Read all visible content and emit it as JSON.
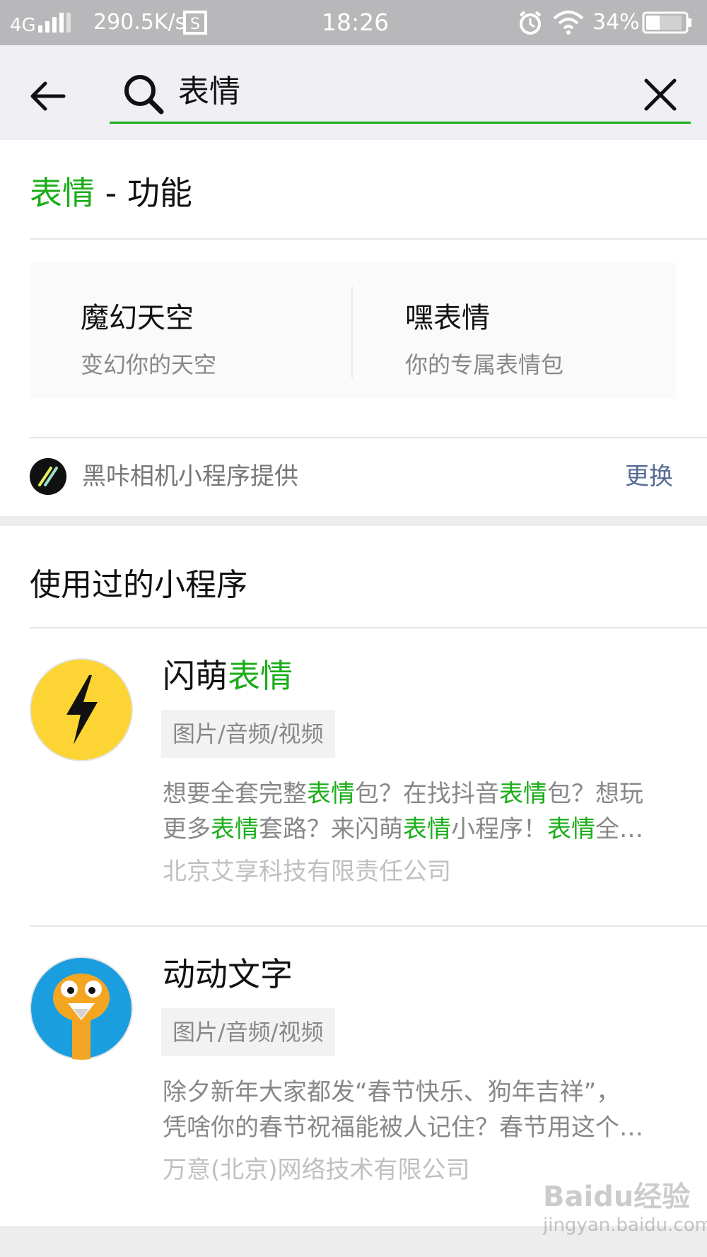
{
  "status_bar": {
    "network": "4G",
    "speed": "290.5K/s",
    "time": "18:26",
    "battery": "34%"
  },
  "search": {
    "query": "表情"
  },
  "function_section": {
    "title_highlight": "表情",
    "title_rest": " - 功能",
    "items": [
      {
        "title": "魔幻天空",
        "subtitle": "变幻你的天空"
      },
      {
        "title": "嘿表情",
        "subtitle": "你的专属表情包"
      }
    ],
    "provider": "黑咔相机小程序提供",
    "change_label": "更换"
  },
  "used_section": {
    "title": "使用过的小程序",
    "apps": [
      {
        "name_plain": "闪萌",
        "name_highlight": "表情",
        "tag": "图片/音频/视频",
        "desc_line1": [
          {
            "t": "想要全套完整",
            "h": false
          },
          {
            "t": "表情",
            "h": true
          },
          {
            "t": "包？在找抖音",
            "h": false
          },
          {
            "t": "表情",
            "h": true
          },
          {
            "t": "包？想玩",
            "h": false
          }
        ],
        "desc_line2": [
          {
            "t": "更多",
            "h": false
          },
          {
            "t": "表情",
            "h": true
          },
          {
            "t": "套路？来闪萌",
            "h": false
          },
          {
            "t": "表情",
            "h": true
          },
          {
            "t": "小程序！",
            "h": false
          },
          {
            "t": "表情",
            "h": true
          },
          {
            "t": "全…",
            "h": false
          }
        ],
        "company": "北京艾享科技有限责任公司"
      },
      {
        "name_plain": "动动文字",
        "tag": "图片/音频/视频",
        "desc_line1_text": "除夕新年大家都发“春节快乐、狗年吉祥”，",
        "desc_line2_text": "凭啥你的春节祝福能被人记住？春节用这个…",
        "company": "万意(北京)网络技术有限公司"
      }
    ]
  },
  "colors": {
    "highlight": "#1aad19",
    "link": "#576b95",
    "status_bar": "#b8b8bb"
  },
  "watermark": {
    "brand": "Baidu经验",
    "url": "jingyan.baidu.com"
  }
}
